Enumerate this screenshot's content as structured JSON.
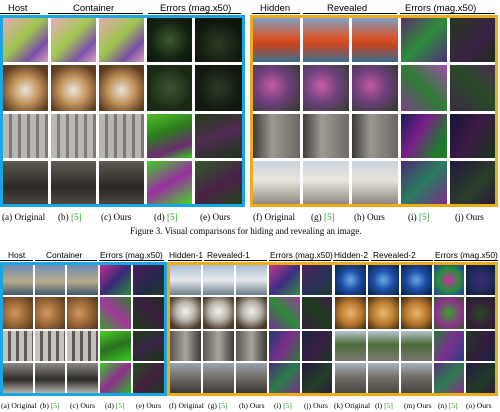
{
  "figure3": {
    "headers": [
      "Host",
      "Container",
      "Errors (mag.x50)",
      "Hidden",
      "Revealed",
      "Errors (mag.x50)"
    ],
    "captions": [
      {
        "pre": "(a) ",
        "label": "Original",
        "ref": ""
      },
      {
        "pre": "(b) ",
        "label": "",
        "ref": "[5]"
      },
      {
        "pre": "(c) ",
        "label": "Ours",
        "ref": ""
      },
      {
        "pre": "(d) ",
        "label": "",
        "ref": "[5]"
      },
      {
        "pre": "(e) ",
        "label": "Ours",
        "ref": ""
      },
      {
        "pre": "(f) ",
        "label": "Original",
        "ref": ""
      },
      {
        "pre": "(g) ",
        "label": "",
        "ref": "[5]"
      },
      {
        "pre": "(h) ",
        "label": "Ours",
        "ref": ""
      },
      {
        "pre": "(i) ",
        "label": "",
        "ref": "[5]"
      },
      {
        "pre": "(j) ",
        "label": "Ours",
        "ref": ""
      }
    ],
    "caption": "Figure 3.  Visual comparisons for hiding and revealing an image."
  },
  "figure4": {
    "headers": [
      "Host",
      "Container",
      "Errors (mag.x50)",
      "Hidden-1",
      "Revealed-1",
      "Errors (mag.x50)",
      "Hidden-2",
      "Revealed-2",
      "Errors (mag.x50)"
    ],
    "captions": [
      {
        "pre": "(a) ",
        "label": "Original",
        "ref": ""
      },
      {
        "pre": "(b) ",
        "label": "",
        "ref": "[5]"
      },
      {
        "pre": "(c) ",
        "label": "Ours",
        "ref": ""
      },
      {
        "pre": "(d) ",
        "label": "",
        "ref": "[5]"
      },
      {
        "pre": "(e) ",
        "label": "Ours",
        "ref": ""
      },
      {
        "pre": "(f) ",
        "label": "Original",
        "ref": ""
      },
      {
        "pre": "(g) ",
        "label": "",
        "ref": "[5]"
      },
      {
        "pre": "(h) ",
        "label": "Ours",
        "ref": ""
      },
      {
        "pre": "(i) ",
        "label": "",
        "ref": "[5]"
      },
      {
        "pre": "(j) ",
        "label": "Ours",
        "ref": ""
      },
      {
        "pre": "(k) ",
        "label": "Original",
        "ref": ""
      },
      {
        "pre": "(l) ",
        "label": "",
        "ref": "[5]"
      },
      {
        "pre": "(m) ",
        "label": "Ours",
        "ref": ""
      },
      {
        "pre": "(n) ",
        "label": "",
        "ref": "[5]"
      },
      {
        "pre": "(o) ",
        "label": "Ours",
        "ref": ""
      }
    ]
  },
  "colors": {
    "frame_blue": "#1ba6e3",
    "frame_gold": "#f0ab1d",
    "ref_green": "#2aa52a"
  },
  "thumbnails": {
    "fig3_left_rows": [
      "macarons",
      "tiger-face",
      "building-facade",
      "shopfront"
    ],
    "fig3_right_rows": [
      "lifeboat",
      "flower-field",
      "street-building",
      "classical-building"
    ],
    "fig4_left_rows": [
      "mountain-lake",
      "desert-rock",
      "building-facade",
      "street-shops"
    ],
    "fig4_mid_rows": [
      "mountain-lake",
      "dog",
      "building-facade",
      "buildings"
    ],
    "fig4_right_rows": [
      "blue-object",
      "bread",
      "tree-building",
      "building"
    ]
  }
}
